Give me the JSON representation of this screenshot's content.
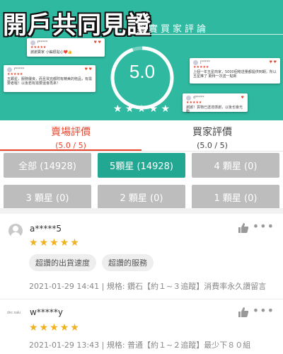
{
  "banner": {
    "brand": "開戶共同見證",
    "title": "真實買家評論",
    "score": "5.0",
    "cards": [
      {
        "user": "f*****",
        "stars": "★★★★★",
        "text": "謝謝賣家 小編很貼心❤️👍"
      },
      {
        "user": "f*****",
        "stars": "★★★★★",
        "text": "五顆星，服務優良，而且買完都附有精美的贈品，有需要者喔！以後若有需要還會再來！"
      },
      {
        "user": "j*****",
        "stars": "★★★★★",
        "text": "上個一年五星商家，5000個贈送量都提供到期，所以五星推了 期待一次送一點新"
      },
      {
        "user": "d*****",
        "stars": "★★★★★",
        "text": "謝謝！貨物已送達感謝，以後也會光臨"
      }
    ]
  },
  "tabs": [
    {
      "label": "賣場評價",
      "sub": "(5.0 / 5)"
    },
    {
      "label": "買家評價",
      "sub": "(5.0 / 5)"
    }
  ],
  "filters": [
    "全部 (14928)",
    "5顆星 (14928)",
    "4 顆星 (0)",
    "3 顆星 (0)",
    "2 顆星 (0)",
    "1 顆星 (0)"
  ],
  "reviews": [
    {
      "name": "a*****5",
      "stars": "★★★★★",
      "tags": [
        "超讚的出貨速度",
        "超讚的服務"
      ],
      "meta": "2021-01-29 14:41 | 規格: 鑽石【約１~３追蹤】消費率永久讚留言"
    },
    {
      "logo": "dnc nalu",
      "name": "w*****y",
      "stars": "★★★★★",
      "meta": "2021-01-29 13:43 | 規格: 普通【約１~２追蹤】最少下８０組"
    }
  ],
  "colors": {
    "banner": "#2fb9a0",
    "accent": "#e8452c",
    "filter_active": "#22a792",
    "filter_idle": "#bdbdbd",
    "star": "#f1b11d"
  },
  "icons": {
    "thumb": "thumbs-up-icon",
    "more": "more-dots-icon"
  }
}
